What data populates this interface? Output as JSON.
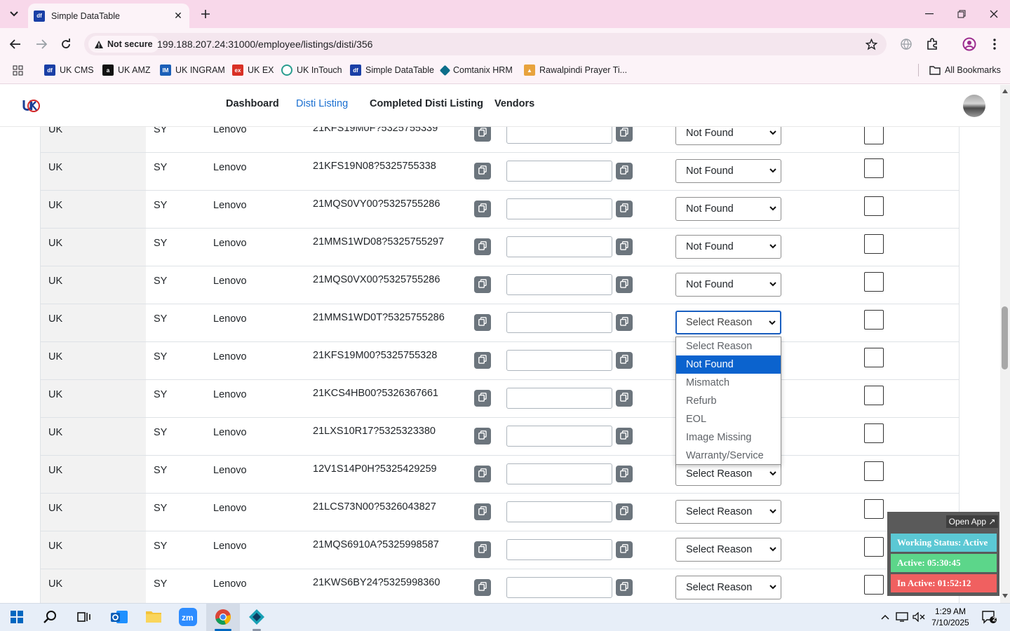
{
  "browser": {
    "tab_title": "Simple DataTable",
    "security_label": "Not secure",
    "url": "199.188.207.24:31000/employee/listings/disti/356",
    "bookmarks": [
      "UK CMS",
      "UK AMZ",
      "UK INGRAM",
      "UK EX",
      "UK InTouch",
      "Simple DataTable",
      "Comtanix HRM",
      "Rawalpindi Prayer Ti..."
    ],
    "all_bookmarks": "All Bookmarks"
  },
  "app": {
    "nav": [
      "Dashboard",
      "Disti Listing",
      "Completed Disti Listing",
      "Vendors"
    ],
    "active_nav": "Disti Listing"
  },
  "table": {
    "rows": [
      {
        "region": "UK",
        "code": "SY",
        "brand": "Lenovo",
        "sku": "21KFS19M0F?5325755339",
        "reason": "Not Found"
      },
      {
        "region": "UK",
        "code": "SY",
        "brand": "Lenovo",
        "sku": "21KFS19N08?5325755338",
        "reason": "Not Found"
      },
      {
        "region": "UK",
        "code": "SY",
        "brand": "Lenovo",
        "sku": "21MQS0VY00?5325755286",
        "reason": "Not Found"
      },
      {
        "region": "UK",
        "code": "SY",
        "brand": "Lenovo",
        "sku": "21MMS1WD08?5325755297",
        "reason": "Not Found"
      },
      {
        "region": "UK",
        "code": "SY",
        "brand": "Lenovo",
        "sku": "21MQS0VX00?5325755286",
        "reason": "Not Found"
      },
      {
        "region": "UK",
        "code": "SY",
        "brand": "Lenovo",
        "sku": "21MMS1WD0T?5325755286",
        "reason": "Select Reason"
      },
      {
        "region": "UK",
        "code": "SY",
        "brand": "Lenovo",
        "sku": "21KFS19M00?5325755328",
        "reason": ""
      },
      {
        "region": "UK",
        "code": "SY",
        "brand": "Lenovo",
        "sku": "21KCS4HB00?5326367661",
        "reason": ""
      },
      {
        "region": "UK",
        "code": "SY",
        "brand": "Lenovo",
        "sku": "21LXS10R17?5325323380",
        "reason": ""
      },
      {
        "region": "UK",
        "code": "SY",
        "brand": "Lenovo",
        "sku": "12V1S14P0H?5325429259",
        "reason": "Select Reason"
      },
      {
        "region": "UK",
        "code": "SY",
        "brand": "Lenovo",
        "sku": "21LCS73N00?5326043827",
        "reason": "Select Reason"
      },
      {
        "region": "UK",
        "code": "SY",
        "brand": "Lenovo",
        "sku": "21MQS6910A?5325998587",
        "reason": "Select Reason"
      },
      {
        "region": "UK",
        "code": "SY",
        "brand": "Lenovo",
        "sku": "21KWS6BY24?5325998360",
        "reason": "Select Reason"
      }
    ],
    "open_dropdown_row": 5,
    "reason_options": [
      "Select Reason",
      "Not Found",
      "Mismatch",
      "Refurb",
      "EOL",
      "Image Missing",
      "Warranty/Service"
    ],
    "highlighted_option": "Not Found"
  },
  "status_widget": {
    "open_app": "Open App ↗",
    "working_status": "Working Status: Active",
    "active": "Active: 05:30:45",
    "inactive": "In Active: 01:52:12",
    "colors": {
      "working": "#5bc8d4",
      "active": "#5cd68a",
      "inactive": "#f06060"
    }
  },
  "taskbar": {
    "time": "1:29 AM",
    "date": "7/10/2025",
    "notifications": "2"
  }
}
